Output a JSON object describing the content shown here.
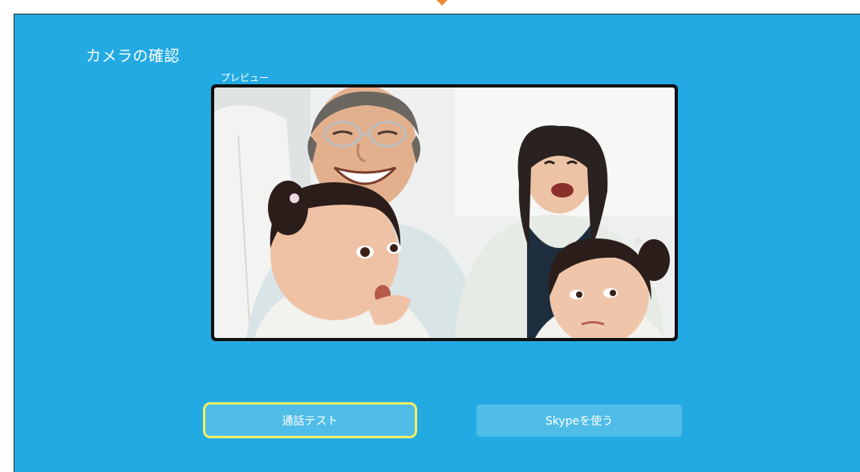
{
  "page": {
    "title": "カメラの確認"
  },
  "preview": {
    "label": "プレビュー"
  },
  "buttons": {
    "call_test": "通話テスト",
    "use_skype": "Skypeを使う"
  },
  "colors": {
    "background": "#24aae3",
    "button": "#4fbde8",
    "focus_ring": "#f2ee62",
    "marker": "#e98b3a"
  }
}
